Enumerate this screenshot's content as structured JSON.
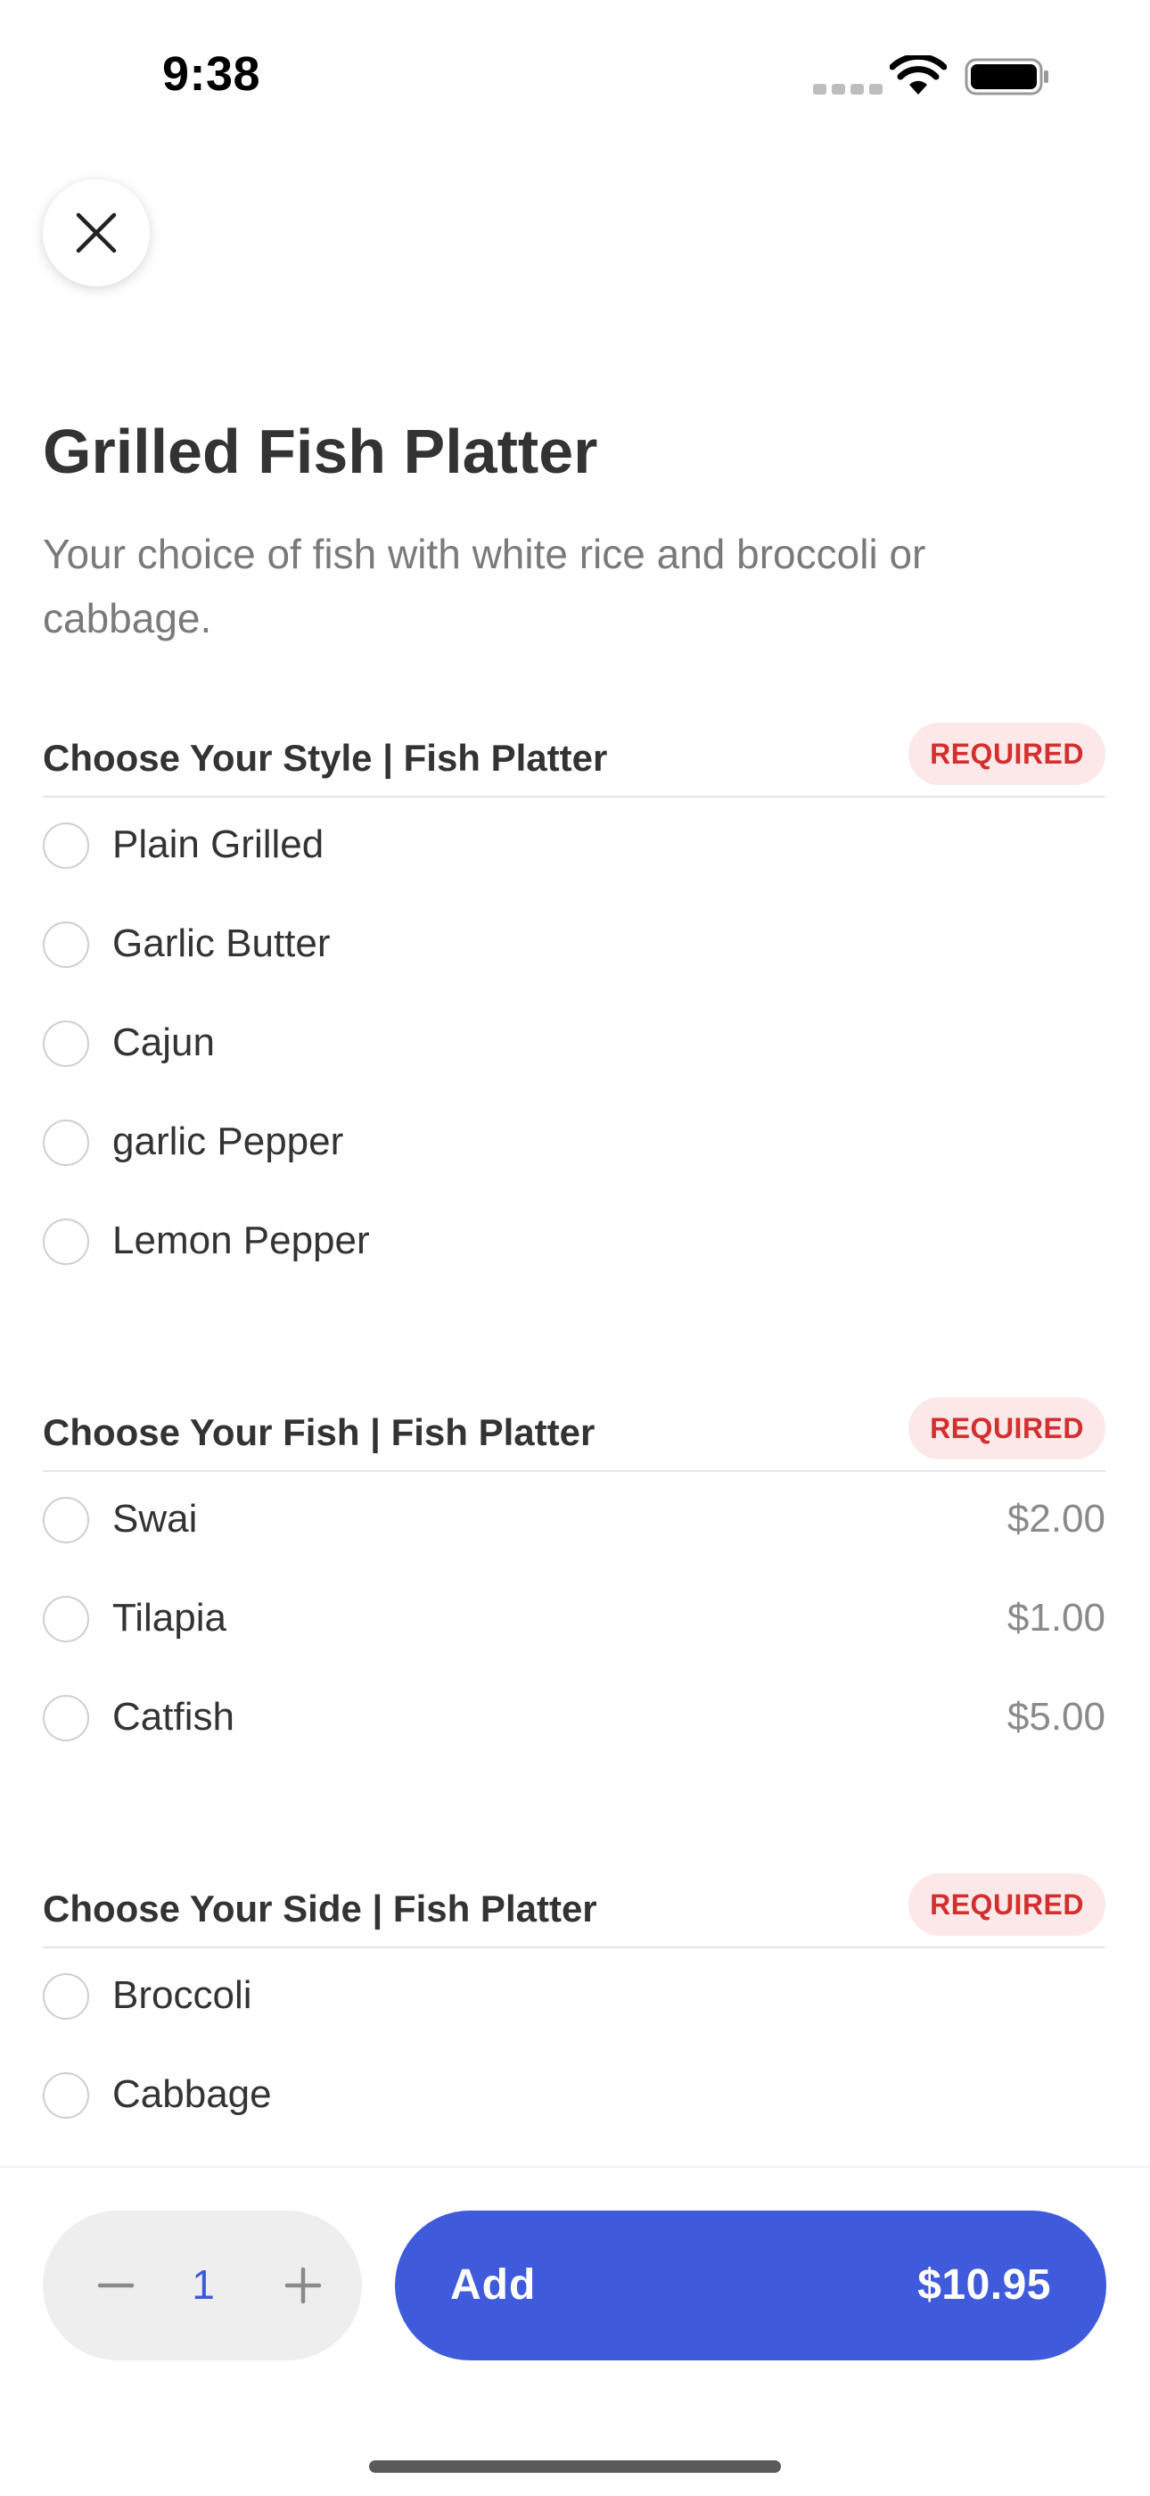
{
  "status_bar": {
    "time": "9:38"
  },
  "item": {
    "title": "Grilled Fish Platter",
    "description": "Your choice of fish with white rice and broccoli or cabbage."
  },
  "groups": [
    {
      "title": "Choose Your Style | Fish Platter",
      "badge": "REQUIRED",
      "options": [
        {
          "label": "Plain Grilled",
          "price": ""
        },
        {
          "label": "Garlic Butter",
          "price": ""
        },
        {
          "label": "Cajun",
          "price": ""
        },
        {
          "label": "garlic Pepper",
          "price": ""
        },
        {
          "label": "Lemon Pepper",
          "price": ""
        }
      ]
    },
    {
      "title": "Choose Your Fish | Fish Platter",
      "badge": "REQUIRED",
      "options": [
        {
          "label": "Swai",
          "price": "$2.00"
        },
        {
          "label": "Tilapia",
          "price": "$1.00"
        },
        {
          "label": "Catfish",
          "price": "$5.00"
        }
      ]
    },
    {
      "title": "Choose Your Side | Fish Platter",
      "badge": "REQUIRED",
      "options": [
        {
          "label": "Broccoli",
          "price": ""
        },
        {
          "label": "Cabbage",
          "price": ""
        }
      ]
    }
  ],
  "footer": {
    "quantity": "1",
    "add_label": "Add",
    "total_price": "$10.95"
  },
  "colors": {
    "accent": "#3f5bdb",
    "required_text": "#d32f2f",
    "required_bg": "#fce8e8"
  },
  "icons": [
    "close-icon",
    "minus-icon",
    "plus-icon",
    "wifi-icon",
    "battery-icon"
  ]
}
